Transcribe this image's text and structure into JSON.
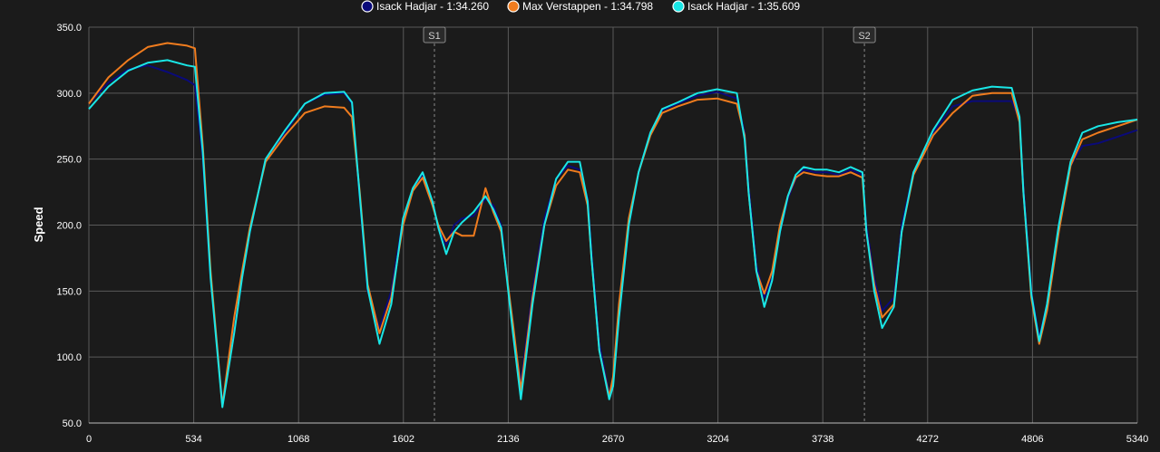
{
  "chart_data": {
    "type": "line",
    "ylabel": "Speed",
    "xlim": [
      0,
      5340
    ],
    "ylim": [
      50,
      350
    ],
    "x_ticks": [
      "0",
      "534",
      "1068",
      "1602",
      "2136",
      "2670",
      "3204",
      "3738",
      "4272",
      "4806",
      "5340"
    ],
    "y_ticks": [
      "50.0",
      "100.0",
      "150.0",
      "200.0",
      "250.0",
      "300.0",
      "350.0"
    ],
    "grid": true,
    "legend_position": "top",
    "sectors": [
      {
        "label": "S1",
        "x": 1760
      },
      {
        "label": "S2",
        "x": 3950
      }
    ],
    "series": [
      {
        "name": "Isack Hadjar - 1:34.260",
        "color": "#0a0a7a",
        "x": [
          0,
          100,
          200,
          300,
          400,
          500,
          540,
          580,
          620,
          680,
          740,
          780,
          820,
          900,
          1000,
          1100,
          1200,
          1300,
          1340,
          1380,
          1420,
          1480,
          1540,
          1600,
          1650,
          1700,
          1750,
          1780,
          1820,
          1860,
          1900,
          1960,
          2020,
          2060,
          2100,
          2160,
          2200,
          2260,
          2320,
          2380,
          2440,
          2500,
          2540,
          2560,
          2600,
          2650,
          2670,
          2700,
          2750,
          2800,
          2860,
          2920,
          3000,
          3100,
          3200,
          3300,
          3340,
          3360,
          3400,
          3440,
          3480,
          3520,
          3560,
          3600,
          3640,
          3700,
          3760,
          3820,
          3880,
          3940,
          3960,
          4000,
          4040,
          4100,
          4140,
          4200,
          4300,
          4400,
          4500,
          4600,
          4700,
          4740,
          4760,
          4800,
          4840,
          4880,
          4940,
          5000,
          5060,
          5140,
          5240,
          5340
        ],
        "values": [
          292,
          308,
          318,
          321,
          316,
          310,
          306,
          250,
          160,
          65,
          120,
          160,
          195,
          250,
          270,
          292,
          299,
          300,
          292,
          220,
          150,
          122,
          150,
          205,
          227,
          238,
          218,
          198,
          185,
          200,
          205,
          207,
          220,
          215,
          200,
          120,
          80,
          150,
          205,
          235,
          245,
          242,
          220,
          180,
          110,
          72,
          80,
          130,
          200,
          240,
          270,
          287,
          292,
          298,
          301,
          296,
          270,
          230,
          170,
          145,
          160,
          195,
          220,
          235,
          242,
          240,
          240,
          238,
          242,
          238,
          200,
          160,
          135,
          145,
          200,
          240,
          270,
          290,
          294,
          294,
          294,
          280,
          230,
          150,
          115,
          140,
          200,
          245,
          260,
          262,
          267,
          272
        ]
      },
      {
        "name": "Max Verstappen - 1:34.798",
        "color": "#f07c1e",
        "x": [
          0,
          100,
          200,
          300,
          400,
          500,
          540,
          580,
          620,
          680,
          740,
          780,
          820,
          900,
          1000,
          1100,
          1200,
          1300,
          1340,
          1380,
          1420,
          1480,
          1540,
          1600,
          1650,
          1700,
          1750,
          1780,
          1820,
          1860,
          1900,
          1960,
          2020,
          2060,
          2100,
          2160,
          2200,
          2260,
          2320,
          2380,
          2440,
          2500,
          2540,
          2560,
          2600,
          2650,
          2670,
          2700,
          2750,
          2800,
          2860,
          2920,
          3000,
          3100,
          3200,
          3300,
          3340,
          3360,
          3400,
          3440,
          3480,
          3520,
          3560,
          3600,
          3640,
          3700,
          3760,
          3820,
          3880,
          3940,
          3960,
          4000,
          4040,
          4100,
          4140,
          4200,
          4300,
          4400,
          4500,
          4600,
          4700,
          4740,
          4760,
          4800,
          4840,
          4880,
          4940,
          5000,
          5060,
          5140,
          5240,
          5340
        ],
        "values": [
          292,
          312,
          325,
          335,
          338,
          336,
          334,
          260,
          165,
          63,
          130,
          165,
          198,
          248,
          268,
          285,
          290,
          289,
          282,
          225,
          155,
          118,
          145,
          200,
          226,
          236,
          215,
          200,
          188,
          195,
          192,
          192,
          228,
          210,
          195,
          125,
          75,
          145,
          200,
          230,
          242,
          240,
          215,
          175,
          105,
          70,
          85,
          140,
          205,
          240,
          268,
          285,
          290,
          295,
          296,
          292,
          268,
          225,
          165,
          148,
          165,
          200,
          222,
          236,
          240,
          238,
          237,
          237,
          240,
          236,
          195,
          155,
          130,
          140,
          195,
          238,
          268,
          285,
          298,
          300,
          300,
          278,
          225,
          145,
          110,
          135,
          195,
          245,
          265,
          270,
          275,
          280
        ]
      },
      {
        "name": "Isack Hadjar - 1:35.609",
        "color": "#19e6e6",
        "x": [
          0,
          100,
          200,
          300,
          400,
          500,
          540,
          580,
          620,
          680,
          740,
          780,
          820,
          900,
          1000,
          1100,
          1200,
          1300,
          1340,
          1380,
          1420,
          1480,
          1540,
          1600,
          1650,
          1700,
          1750,
          1780,
          1820,
          1860,
          1900,
          1960,
          2020,
          2060,
          2100,
          2160,
          2200,
          2260,
          2320,
          2380,
          2440,
          2500,
          2540,
          2560,
          2600,
          2650,
          2670,
          2700,
          2750,
          2800,
          2860,
          2920,
          3000,
          3100,
          3200,
          3300,
          3340,
          3360,
          3400,
          3440,
          3480,
          3520,
          3560,
          3600,
          3640,
          3700,
          3760,
          3820,
          3880,
          3940,
          3960,
          4000,
          4040,
          4100,
          4140,
          4200,
          4300,
          4400,
          4500,
          4600,
          4700,
          4740,
          4760,
          4800,
          4840,
          4880,
          4940,
          5000,
          5060,
          5140,
          5240,
          5340
        ],
        "values": [
          288,
          305,
          317,
          323,
          325,
          321,
          320,
          255,
          160,
          62,
          118,
          160,
          195,
          250,
          272,
          292,
          300,
          301,
          293,
          222,
          152,
          110,
          140,
          205,
          228,
          240,
          218,
          198,
          178,
          195,
          202,
          210,
          222,
          212,
          198,
          118,
          68,
          140,
          200,
          235,
          248,
          248,
          218,
          175,
          105,
          68,
          78,
          130,
          200,
          240,
          270,
          288,
          293,
          300,
          303,
          300,
          265,
          225,
          165,
          138,
          158,
          195,
          222,
          238,
          244,
          242,
          242,
          240,
          244,
          240,
          195,
          150,
          122,
          138,
          195,
          240,
          272,
          295,
          302,
          305,
          304,
          282,
          225,
          148,
          112,
          140,
          200,
          248,
          270,
          275,
          278,
          280
        ]
      }
    ]
  }
}
